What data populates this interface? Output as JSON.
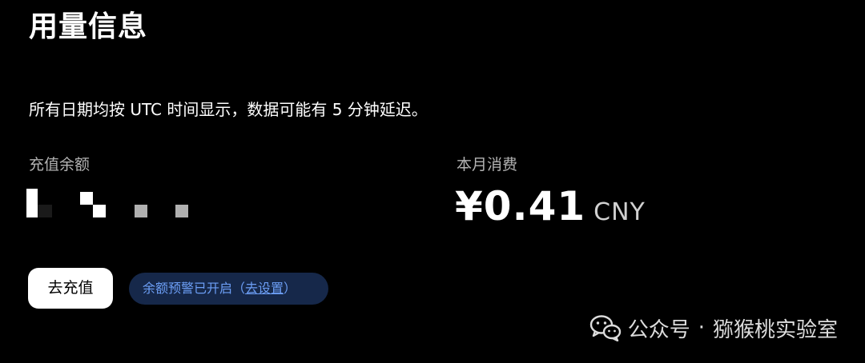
{
  "header": {
    "title": "用量信息"
  },
  "notice": {
    "text": "所有日期均按 UTC 时间显示，数据可能有 5 分钟延迟。"
  },
  "balance": {
    "label": "充值余额"
  },
  "monthly_spend": {
    "label": "本月消费",
    "amount": "¥0.41",
    "currency": "CNY"
  },
  "actions": {
    "recharge_label": "去充值",
    "alert_prefix": "余额预警已开启（",
    "alert_link": "去设置",
    "alert_suffix": "）"
  },
  "watermark": {
    "prefix": "公众号",
    "separator": "·",
    "name": "猕猴桃实验室"
  },
  "colors": {
    "background": "#000000",
    "button_bg": "#ffffff",
    "pill_bg": "#16284a",
    "link": "#6c9ef5",
    "muted_text": "#b3b3b3"
  },
  "icons": [
    "wechat-icon"
  ]
}
